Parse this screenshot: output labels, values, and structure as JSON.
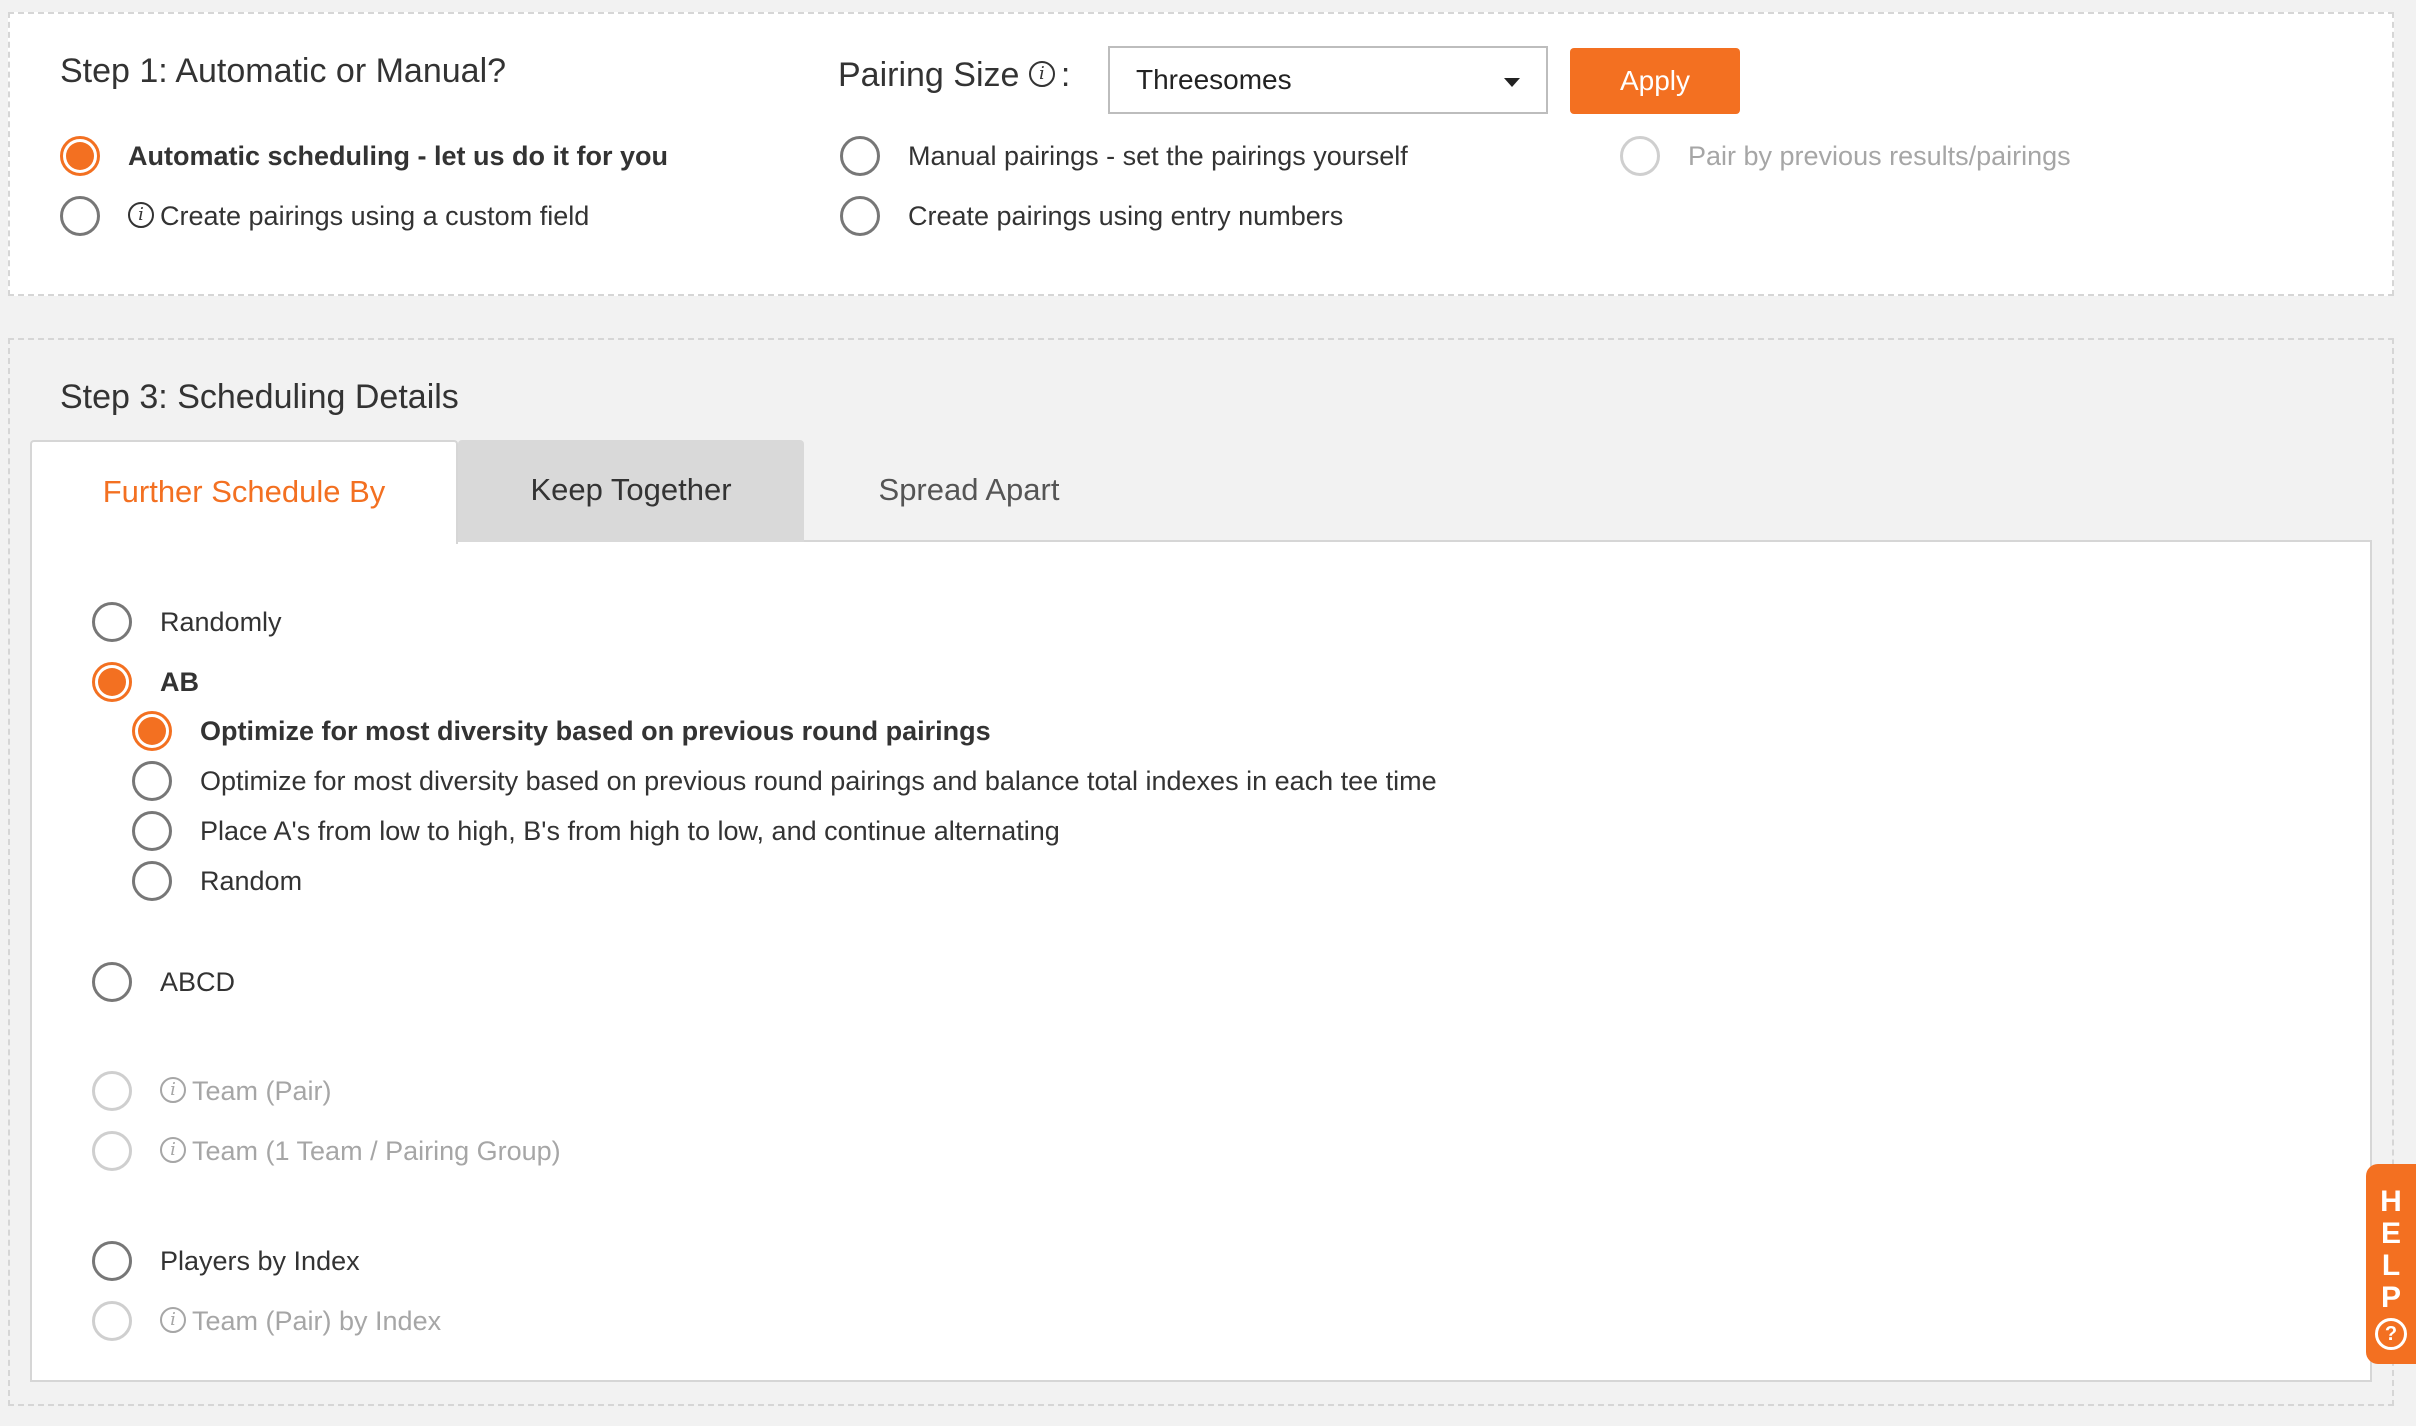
{
  "step1": {
    "title": "Step 1: Automatic or Manual?",
    "pairing_size_label": "Pairing Size",
    "pairing_size_colon": ":",
    "pairing_size_value": "Threesomes",
    "apply_label": "Apply",
    "options": {
      "automatic": "Automatic scheduling - let us do it for you",
      "custom_field": "Create pairings using a custom field",
      "manual": "Manual pairings - set the pairings yourself",
      "entry_numbers": "Create pairings using entry numbers",
      "previous_results": "Pair by previous results/pairings"
    }
  },
  "step3": {
    "title": "Step 3: Scheduling Details",
    "tabs": {
      "further": "Further Schedule By",
      "keep": "Keep Together",
      "spread": "Spread Apart"
    },
    "options": {
      "randomly": "Randomly",
      "ab": "AB",
      "ab_sub1": "Optimize for most diversity based on previous round pairings",
      "ab_sub2": "Optimize for most diversity based on previous round pairings and balance total indexes in each tee time",
      "ab_sub3": "Place A's from low to high, B's from high to low, and continue alternating",
      "ab_sub4": "Random",
      "abcd": "ABCD",
      "team_pair": "Team (Pair)",
      "team_group": "Team (1 Team / Pairing Group)",
      "players_index": "Players by Index",
      "team_pair_index": "Team (Pair) by Index"
    }
  },
  "help": {
    "letters": [
      "H",
      "E",
      "L",
      "P"
    ],
    "question": "?"
  },
  "colors": {
    "accent": "#f37021"
  }
}
